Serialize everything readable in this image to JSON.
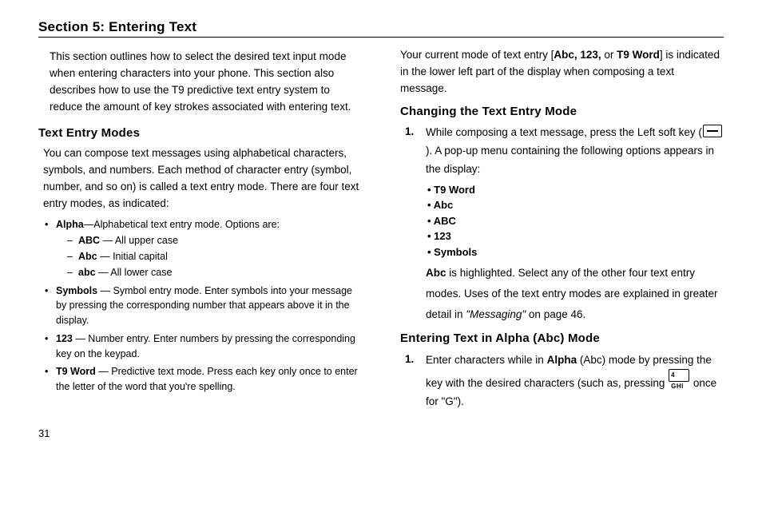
{
  "section_title": "Section 5: Entering Text",
  "intro": "This section outlines how to select the desired text input mode when entering characters into your phone. This section also describes how to use the T9 predictive text entry system to reduce the amount of key strokes associated with entering text.",
  "text_entry": {
    "heading": "Text Entry Modes",
    "lead": "You can compose text messages using alphabetical characters, symbols, and numbers. Each method of character entry (symbol, number, and so on) is called a text entry mode. There are four text entry modes, as indicated:",
    "alpha": {
      "label": "Alpha",
      "desc": "—Alphabetical text entry mode. Options are:",
      "opts": [
        {
          "b": "ABC",
          "t": " — All upper case"
        },
        {
          "b": "Abc",
          "t": " — Initial capital"
        },
        {
          "b": "abc",
          "t": " — All lower case"
        }
      ]
    },
    "symbols": {
      "label": "Symbols",
      "desc": " — Symbol entry mode. Enter symbols into your message by pressing the corresponding number that appears above it in the display."
    },
    "n123": {
      "label": "123",
      "desc": " — Number entry. Enter numbers by pressing the corresponding key on the keypad."
    },
    "t9": {
      "label": "T9 Word",
      "desc": " — Predictive text mode. Press each key only once to enter the letter of the word that you're spelling."
    }
  },
  "right": {
    "current_mode_1": "Your current mode of text entry [",
    "current_mode_modes": "Abc, 123,",
    "current_mode_or": " or ",
    "current_mode_t9": "T9 Word",
    "current_mode_2": "] is indicated in the lower left part of the display when composing a text message.",
    "changing": {
      "heading": "Changing the Text Entry Mode",
      "step1_a": "While composing a text message, press the Left soft key (",
      "step1_b": "). A pop-up menu containing the following options appears in the display:",
      "options": [
        "T9 Word",
        "Abc",
        "ABC",
        "123",
        "Symbols"
      ],
      "note_b": "Abc",
      "note_1": " is highlighted. Select any of the other four text entry modes. Uses of the text entry modes are explained in greater detail in ",
      "note_i": "\"Messaging\"",
      "note_2": " on page 46."
    },
    "alpha_enter": {
      "heading": "Entering Text in Alpha (Abc) Mode",
      "step1_a": "Enter characters while in ",
      "step1_b": "Alpha",
      "step1_c": " (Abc) mode by pressing the key with the desired characters (such as, pressing ",
      "step1_d": " once for \"G\")."
    }
  },
  "page_number": "31"
}
